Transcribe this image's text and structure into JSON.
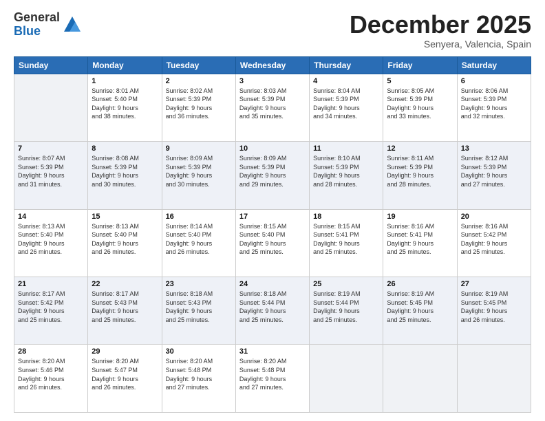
{
  "header": {
    "logo_general": "General",
    "logo_blue": "Blue",
    "month": "December 2025",
    "location": "Senyera, Valencia, Spain"
  },
  "weekdays": [
    "Sunday",
    "Monday",
    "Tuesday",
    "Wednesday",
    "Thursday",
    "Friday",
    "Saturday"
  ],
  "weeks": [
    [
      {
        "day": "",
        "info": ""
      },
      {
        "day": "1",
        "info": "Sunrise: 8:01 AM\nSunset: 5:40 PM\nDaylight: 9 hours\nand 38 minutes."
      },
      {
        "day": "2",
        "info": "Sunrise: 8:02 AM\nSunset: 5:39 PM\nDaylight: 9 hours\nand 36 minutes."
      },
      {
        "day": "3",
        "info": "Sunrise: 8:03 AM\nSunset: 5:39 PM\nDaylight: 9 hours\nand 35 minutes."
      },
      {
        "day": "4",
        "info": "Sunrise: 8:04 AM\nSunset: 5:39 PM\nDaylight: 9 hours\nand 34 minutes."
      },
      {
        "day": "5",
        "info": "Sunrise: 8:05 AM\nSunset: 5:39 PM\nDaylight: 9 hours\nand 33 minutes."
      },
      {
        "day": "6",
        "info": "Sunrise: 8:06 AM\nSunset: 5:39 PM\nDaylight: 9 hours\nand 32 minutes."
      }
    ],
    [
      {
        "day": "7",
        "info": "Sunrise: 8:07 AM\nSunset: 5:39 PM\nDaylight: 9 hours\nand 31 minutes."
      },
      {
        "day": "8",
        "info": "Sunrise: 8:08 AM\nSunset: 5:39 PM\nDaylight: 9 hours\nand 30 minutes."
      },
      {
        "day": "9",
        "info": "Sunrise: 8:09 AM\nSunset: 5:39 PM\nDaylight: 9 hours\nand 30 minutes."
      },
      {
        "day": "10",
        "info": "Sunrise: 8:09 AM\nSunset: 5:39 PM\nDaylight: 9 hours\nand 29 minutes."
      },
      {
        "day": "11",
        "info": "Sunrise: 8:10 AM\nSunset: 5:39 PM\nDaylight: 9 hours\nand 28 minutes."
      },
      {
        "day": "12",
        "info": "Sunrise: 8:11 AM\nSunset: 5:39 PM\nDaylight: 9 hours\nand 28 minutes."
      },
      {
        "day": "13",
        "info": "Sunrise: 8:12 AM\nSunset: 5:39 PM\nDaylight: 9 hours\nand 27 minutes."
      }
    ],
    [
      {
        "day": "14",
        "info": "Sunrise: 8:13 AM\nSunset: 5:40 PM\nDaylight: 9 hours\nand 26 minutes."
      },
      {
        "day": "15",
        "info": "Sunrise: 8:13 AM\nSunset: 5:40 PM\nDaylight: 9 hours\nand 26 minutes."
      },
      {
        "day": "16",
        "info": "Sunrise: 8:14 AM\nSunset: 5:40 PM\nDaylight: 9 hours\nand 26 minutes."
      },
      {
        "day": "17",
        "info": "Sunrise: 8:15 AM\nSunset: 5:40 PM\nDaylight: 9 hours\nand 25 minutes."
      },
      {
        "day": "18",
        "info": "Sunrise: 8:15 AM\nSunset: 5:41 PM\nDaylight: 9 hours\nand 25 minutes."
      },
      {
        "day": "19",
        "info": "Sunrise: 8:16 AM\nSunset: 5:41 PM\nDaylight: 9 hours\nand 25 minutes."
      },
      {
        "day": "20",
        "info": "Sunrise: 8:16 AM\nSunset: 5:42 PM\nDaylight: 9 hours\nand 25 minutes."
      }
    ],
    [
      {
        "day": "21",
        "info": "Sunrise: 8:17 AM\nSunset: 5:42 PM\nDaylight: 9 hours\nand 25 minutes."
      },
      {
        "day": "22",
        "info": "Sunrise: 8:17 AM\nSunset: 5:43 PM\nDaylight: 9 hours\nand 25 minutes."
      },
      {
        "day": "23",
        "info": "Sunrise: 8:18 AM\nSunset: 5:43 PM\nDaylight: 9 hours\nand 25 minutes."
      },
      {
        "day": "24",
        "info": "Sunrise: 8:18 AM\nSunset: 5:44 PM\nDaylight: 9 hours\nand 25 minutes."
      },
      {
        "day": "25",
        "info": "Sunrise: 8:19 AM\nSunset: 5:44 PM\nDaylight: 9 hours\nand 25 minutes."
      },
      {
        "day": "26",
        "info": "Sunrise: 8:19 AM\nSunset: 5:45 PM\nDaylight: 9 hours\nand 25 minutes."
      },
      {
        "day": "27",
        "info": "Sunrise: 8:19 AM\nSunset: 5:45 PM\nDaylight: 9 hours\nand 26 minutes."
      }
    ],
    [
      {
        "day": "28",
        "info": "Sunrise: 8:20 AM\nSunset: 5:46 PM\nDaylight: 9 hours\nand 26 minutes."
      },
      {
        "day": "29",
        "info": "Sunrise: 8:20 AM\nSunset: 5:47 PM\nDaylight: 9 hours\nand 26 minutes."
      },
      {
        "day": "30",
        "info": "Sunrise: 8:20 AM\nSunset: 5:48 PM\nDaylight: 9 hours\nand 27 minutes."
      },
      {
        "day": "31",
        "info": "Sunrise: 8:20 AM\nSunset: 5:48 PM\nDaylight: 9 hours\nand 27 minutes."
      },
      {
        "day": "",
        "info": ""
      },
      {
        "day": "",
        "info": ""
      },
      {
        "day": "",
        "info": ""
      }
    ]
  ]
}
